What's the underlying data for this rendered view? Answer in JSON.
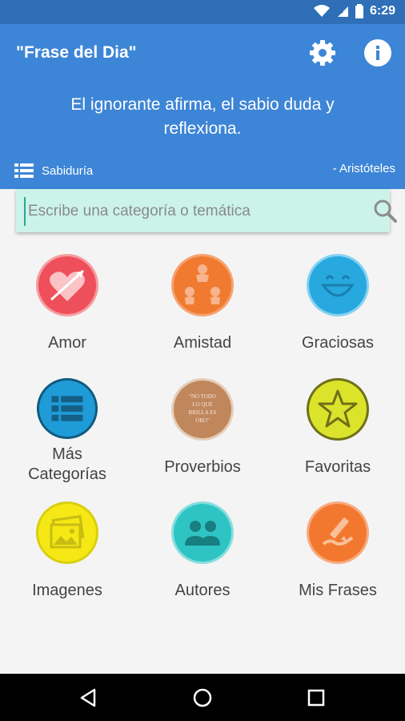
{
  "status_bar": {
    "time": "6:29"
  },
  "header": {
    "title": "\"Frase del Dia\"",
    "quote": "El ignorante afirma, el sabio duda y reflexiona.",
    "category": "Sabiduría",
    "author": "- Aristóteles"
  },
  "search": {
    "placeholder": "Escribe una categoría o temática"
  },
  "categories": [
    {
      "label": "Amor",
      "icon": "heart-arrow-icon",
      "color": "#ef4f5a"
    },
    {
      "label": "Amistad",
      "icon": "friends-circle-icon",
      "color": "#f07a30"
    },
    {
      "label": "Graciosas",
      "icon": "smile-icon",
      "color": "#27a8de"
    },
    {
      "label": "Más\nCategorías",
      "icon": "list-icon",
      "color": "#1f9bd7"
    },
    {
      "label": "Proverbios",
      "icon": "stamp-icon",
      "color": "#c0875d",
      "badge_text": "\"NO TODO LO QUE BRILLA ES ORO\""
    },
    {
      "label": "Favoritas",
      "icon": "star-icon",
      "color": "#dbe42a"
    },
    {
      "label": "Imagenes",
      "icon": "images-icon",
      "color": "#f5e814"
    },
    {
      "label": "Autores",
      "icon": "people-icon",
      "color": "#2fc4c4"
    },
    {
      "label": "Mis Frases",
      "icon": "write-icon",
      "color": "#f3782f"
    }
  ],
  "colors": {
    "header": "#3d85d6",
    "status": "#2e6fb8",
    "search_bg": "#cbf3ea"
  }
}
